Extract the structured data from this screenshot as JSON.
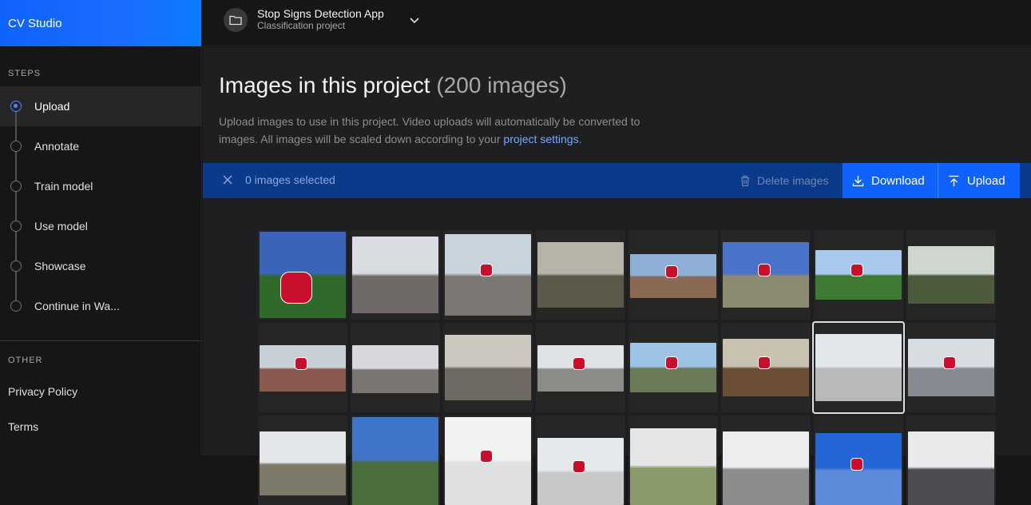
{
  "brand": "CV Studio",
  "sidebar": {
    "steps_label": "STEPS",
    "steps": [
      {
        "label": "Upload",
        "active": true
      },
      {
        "label": "Annotate",
        "active": false
      },
      {
        "label": "Train model",
        "active": false
      },
      {
        "label": "Use model",
        "active": false
      },
      {
        "label": "Showcase",
        "active": false
      },
      {
        "label": "Continue in Wa...",
        "active": false
      }
    ],
    "other_label": "OTHER",
    "other_links": [
      "Privacy Policy",
      "Terms"
    ]
  },
  "header": {
    "project_name": "Stop Signs Detection App",
    "project_type": "Classification project"
  },
  "main": {
    "title": "Images in this project",
    "title_count": "(200 images)",
    "description": "Upload images to use in this project. Video uploads will automatically be converted to images. All images will be scaled down according to your",
    "description_link": "project settings",
    "description_end": "."
  },
  "toolbar": {
    "selected_count": "0 images selected",
    "delete_label": "Delete images",
    "download_label": "Download",
    "upload_label": "Upload"
  },
  "colors": {
    "accent": "#0f62fe",
    "toolbar_bg": "#0b3a8a",
    "link": "#78a9ff"
  },
  "thumbnails": [
    {
      "desc": "stop sign with street sign 154 ST",
      "sky": "#3a64b8",
      "ground": "#2f6a2a",
      "sign": true
    },
    {
      "desc": "suburban road with trees",
      "sky": "#d9dde2",
      "ground": "#6f6a68",
      "sign": false
    },
    {
      "desc": "street intersection with stop sign",
      "sky": "#c9d3dc",
      "ground": "#7b7773",
      "sign": true
    },
    {
      "desc": "rural road at hazy dusk",
      "sky": "#b8b3a8",
      "ground": "#5b5a4a",
      "sign": false
    },
    {
      "desc": "brick building with stop sign",
      "sky": "#8fb0d6",
      "ground": "#8a6a55",
      "sign": true
    },
    {
      "desc": "stop sign with blue street signs and mountains",
      "sky": "#4a72c8",
      "ground": "#8c8a70",
      "sign": true
    },
    {
      "desc": "stop sign in front of green trees",
      "sky": "#a8c8ee",
      "ground": "#3e7a32",
      "sign": true
    },
    {
      "desc": "cyclist on trail with green sign",
      "sky": "#cfd6d0",
      "ground": "#4c5b3b",
      "sign": false
    },
    {
      "desc": "stop sign on urban street",
      "sky": "#c9cfd6",
      "ground": "#8a5a50",
      "sign": true
    },
    {
      "desc": "winter road intersection",
      "sky": "#d6d8dc",
      "ground": "#7a7472",
      "sign": false
    },
    {
      "desc": "rural road with bare trees",
      "sky": "#cbc8c0",
      "ground": "#6d6a62",
      "sign": false
    },
    {
      "desc": "STOP painted on road",
      "sky": "#dfe3e6",
      "ground": "#8d8b88",
      "sign": true
    },
    {
      "desc": "stop sign with car",
      "sky": "#9cc3e6",
      "ground": "#6b7a58",
      "sign": true
    },
    {
      "desc": "stop sign in dry field",
      "sky": "#c9c2b0",
      "ground": "#6a4e36",
      "sign": true
    },
    {
      "desc": "snowy road with bare trees",
      "sky": "#e4e7ea",
      "ground": "#b9b9b9",
      "sign": false
    },
    {
      "desc": "stop sign on wet road",
      "sky": "#d8dde2",
      "ground": "#858b90",
      "sign": true
    },
    {
      "desc": "street with houses",
      "sky": "#e3e6ea",
      "ground": "#7d7a6a",
      "sign": false
    },
    {
      "desc": "blue sky with sign",
      "sky": "#3f74c8",
      "ground": "#4b6e3a",
      "sign": false
    },
    {
      "desc": "stop sign close up",
      "sky": "#f2f2f2",
      "ground": "#e0e0e0",
      "sign": true
    },
    {
      "desc": "stop sign on pole",
      "sky": "#e6e9ec",
      "ground": "#c8c8c8",
      "sign": true
    },
    {
      "desc": "road with trees",
      "sky": "#e4e5e6",
      "ground": "#8a9a6a",
      "sign": false
    },
    {
      "desc": "power lines and trees",
      "sky": "#eceef0",
      "ground": "#8c8c8c",
      "sign": false
    },
    {
      "desc": "stop sign against blue sky",
      "sky": "#2466d6",
      "ground": "#5a8ad8",
      "sign": true
    },
    {
      "desc": "building with fence",
      "sky": "#e8eaec",
      "ground": "#4a4c50",
      "sign": false
    }
  ]
}
